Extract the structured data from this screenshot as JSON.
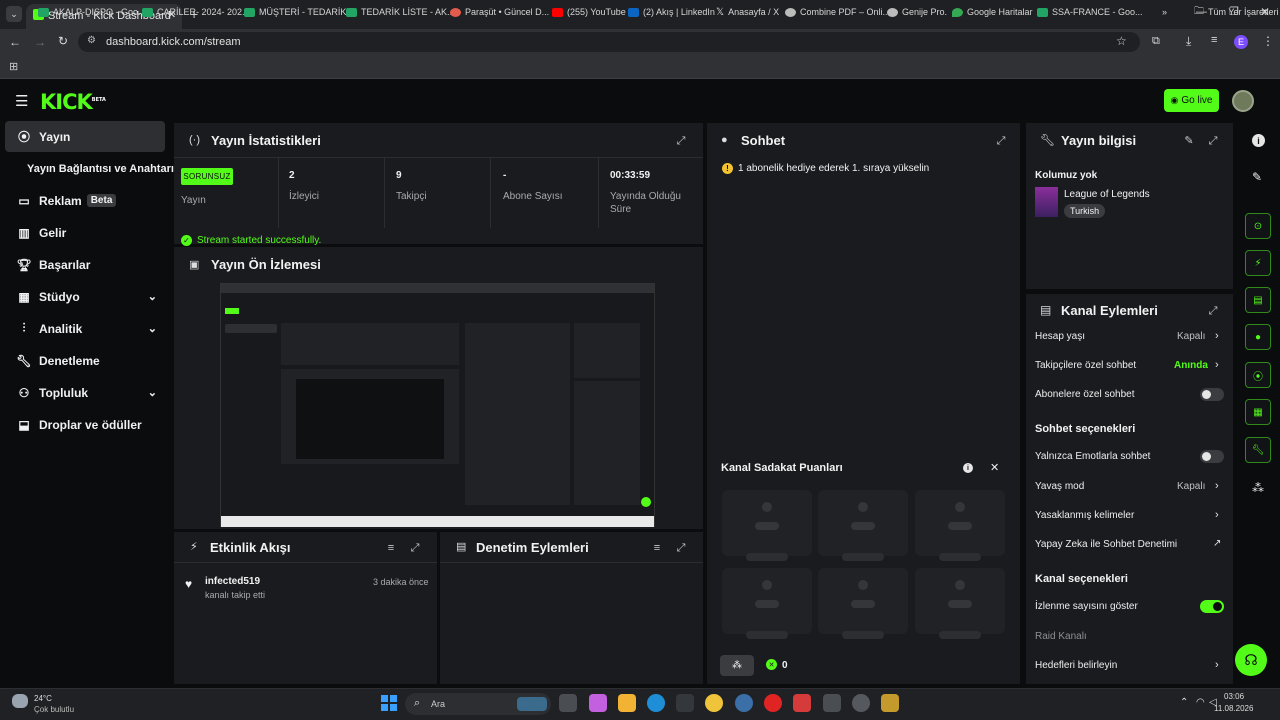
{
  "browser": {
    "tab_title": "Stream - Kick Dashboard",
    "url": "dashboard.kick.com/stream",
    "bookmarks": [
      "AKALP-DISPO - Goo...",
      "CARİLER- 2024- 202...",
      "MÜŞTERİ - TEDARİK...",
      "TEDARİK LİSTE - AK...",
      "Paraşüt • Güncel D...",
      "(255) YouTube",
      "(2) Akış | LinkedIn",
      "Anasayfa / X",
      "Combine PDF – Onli...",
      "Genije Pro.",
      "Google Haritalar",
      "SSA-FRANCE - Goo..."
    ],
    "all_bookmarks": "Tüm Yer İşaretleri",
    "profile_letter": "E"
  },
  "header": {
    "logo": "KICK",
    "logo_sup": "BETA",
    "go_live": "Go live"
  },
  "sidebar": {
    "items": [
      {
        "label": "Yayın",
        "icon": "broadcast-icon"
      },
      {
        "label": "Yayın Bağlantısı ve Anahtarı"
      },
      {
        "label": "Reklam",
        "badge": "Beta",
        "icon": "ad-icon"
      },
      {
        "label": "Gelir",
        "icon": "chart-icon"
      },
      {
        "label": "Başarılar",
        "icon": "trophy-icon"
      },
      {
        "label": "Stüdyo",
        "icon": "studio-icon"
      },
      {
        "label": "Analitik",
        "icon": "analytics-icon"
      },
      {
        "label": "Denetleme",
        "icon": "wrench-icon"
      },
      {
        "label": "Topluluk",
        "icon": "community-icon"
      },
      {
        "label": "Droplar ve ödüller",
        "icon": "drops-icon"
      }
    ]
  },
  "stats": {
    "title": "Yayın İstatistikleri",
    "status_badge": "SORUNSUZ",
    "status_label": "Yayın",
    "viewers_value": "2",
    "viewers_label": "İzleyici",
    "followers_value": "9",
    "followers_label": "Takipçi",
    "subs_value": "-",
    "subs_label": "Abone Sayısı",
    "uptime_value": "00:33:59",
    "uptime_label_1": "Yayında Olduğu",
    "uptime_label_2": "Süre",
    "message": "Stream started successfully."
  },
  "preview": {
    "title": "Yayın Ön İzlemesi"
  },
  "activity": {
    "title": "Etkinlik Akışı",
    "user": "infected519",
    "event": "kanalı takip etti",
    "time": "3 dakika önce"
  },
  "moderation": {
    "title": "Denetim Eylemleri"
  },
  "chat": {
    "title": "Sohbet",
    "goal": "1 abonelik hediye ederek 1. sıraya yükselin",
    "loyalty_title": "Kanal Sadakat Puanları",
    "points": "0"
  },
  "stream_info": {
    "title": "Yayın bilgisi",
    "column": "Kolumuz yok",
    "category": "League of Legends",
    "language": "Turkish"
  },
  "channel_actions": {
    "title": "Kanal Eylemleri",
    "account_age": "Hesap yaşı",
    "account_age_value": "Kapalı",
    "followers_only": "Takipçilere özel sohbet",
    "followers_only_value": "Anında",
    "subs_only": "Abonelere özel sohbet",
    "chat_options": "Sohbet seçenekleri",
    "emote_only": "Yalnızca Emotlarla sohbet",
    "slow_mode": "Yavaş mod",
    "slow_mode_value": "Kapalı",
    "banned_words": "Yasaklanmış kelimeler",
    "ai_moderation": "Yapay Zeka ile Sohbet Denetimi",
    "channel_options": "Kanal seçenekleri",
    "show_viewers": "İzlenme sayısını göster",
    "raid": "Raid Kanalı",
    "set_goals": "Hedefleri belirleyin"
  },
  "taskbar": {
    "weather_temp": "24°C",
    "weather_desc": "Çok bulutlu",
    "search": "Ara",
    "time": "03:06",
    "date": "11.08.2026"
  },
  "colors": {
    "accent": "#53fc18",
    "panel": "#191b1f",
    "bg": "#0b0c0e"
  }
}
